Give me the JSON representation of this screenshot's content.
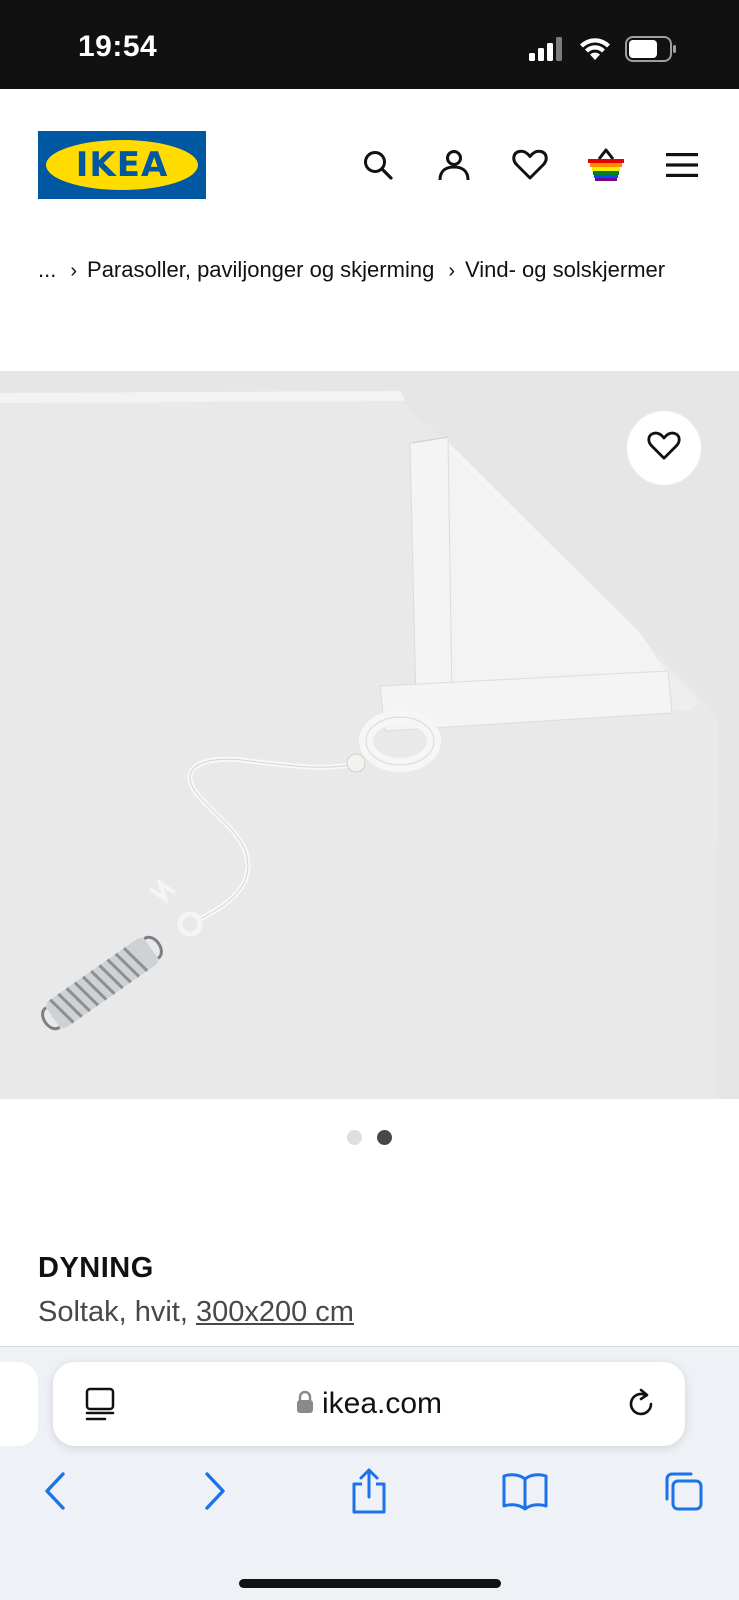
{
  "status_bar": {
    "time": "19:54",
    "icons": [
      "signal-icon",
      "wifi-icon",
      "battery-icon"
    ]
  },
  "header": {
    "logo_text": "IKEA",
    "logo_colors": {
      "background": "#0058a3",
      "ellipse": "#ffdb00"
    },
    "icons": [
      "search-icon",
      "account-icon",
      "wishlist-icon",
      "basket-icon",
      "menu-icon"
    ]
  },
  "breadcrumb": {
    "ellipsis": "...",
    "items": [
      {
        "label": "Parasoller, paviljonger og skjerming"
      },
      {
        "label": "Vind- og solskjermer"
      }
    ]
  },
  "product_image": {
    "icon": "heart-icon",
    "dots_total": 2,
    "active_dot": 2
  },
  "product": {
    "name": "DYNING",
    "description": "Soltak, hvit,",
    "size": "300x200 cm"
  },
  "browser": {
    "url": "ikea.com",
    "colors": {
      "accent": "#1a73e8"
    },
    "toolbar_icons": [
      "back-icon",
      "forward-icon",
      "share-icon",
      "bookmarks-icon",
      "tabs-icon"
    ]
  }
}
